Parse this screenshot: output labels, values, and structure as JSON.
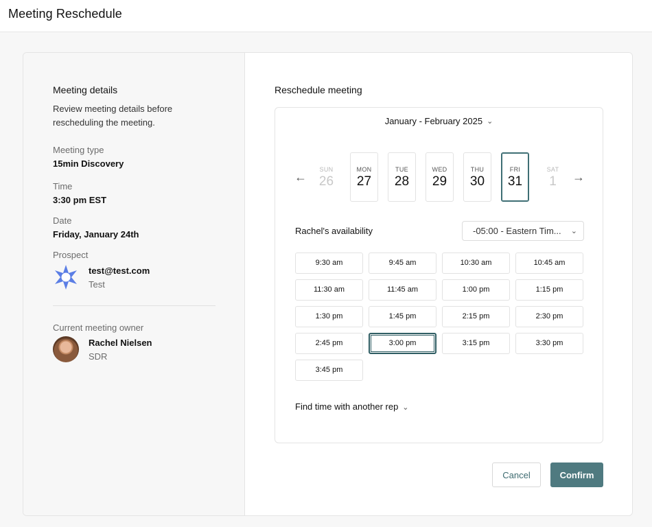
{
  "app": {
    "title": "Meeting Reschedule"
  },
  "details": {
    "title": "Meeting details",
    "description": "Review meeting details before rescheduling the meeting.",
    "meeting_type_label": "Meeting type",
    "meeting_type": "15min Discovery",
    "time_label": "Time",
    "time": "3:30 pm EST",
    "date_label": "Date",
    "date": "Friday, January 24th",
    "prospect_label": "Prospect",
    "prospect_email": "test@test.com",
    "prospect_company": "Test",
    "owner_label": "Current meeting owner",
    "owner_name": "Rachel Nielsen",
    "owner_role": "SDR"
  },
  "reschedule": {
    "title": "Reschedule meeting",
    "month_range": "January - February 2025",
    "days": [
      {
        "dow": "SUN",
        "num": "26",
        "state": "disabled"
      },
      {
        "dow": "MON",
        "num": "27",
        "state": "available"
      },
      {
        "dow": "TUE",
        "num": "28",
        "state": "available"
      },
      {
        "dow": "WED",
        "num": "29",
        "state": "available"
      },
      {
        "dow": "THU",
        "num": "30",
        "state": "available"
      },
      {
        "dow": "FRI",
        "num": "31",
        "state": "selected"
      },
      {
        "dow": "SAT",
        "num": "1",
        "state": "disabled"
      }
    ],
    "availability_label": "Rachel's availability",
    "timezone": "-05:00 - Eastern Tim...",
    "slots": [
      "9:30 am",
      "9:45 am",
      "10:30 am",
      "10:45 am",
      "11:30 am",
      "11:45 am",
      "1:00 pm",
      "1:15 pm",
      "1:30 pm",
      "1:45 pm",
      "2:15 pm",
      "2:30 pm",
      "2:45 pm",
      "3:00 pm",
      "3:15 pm",
      "3:30 pm",
      "3:45 pm"
    ],
    "selected_slot": "3:00 pm",
    "find_rep_label": "Find time with another rep"
  },
  "actions": {
    "cancel_label": "Cancel",
    "confirm_label": "Confirm"
  },
  "colors": {
    "accent": "#4f7a80",
    "selected_border": "#2f5d63",
    "logo": "#5b7ee5"
  }
}
